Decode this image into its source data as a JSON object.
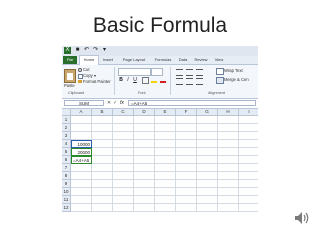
{
  "slide": {
    "title": "Basic Formula"
  },
  "tabs": [
    "File",
    "Home",
    "Insert",
    "Page Layout",
    "Formulas",
    "Data",
    "Review",
    "View"
  ],
  "ribbon": {
    "paste_label": "Paste",
    "cut_label": "Cut",
    "copy_label": "Copy ▾",
    "format_painter_label": "Format Painter",
    "clipboard_group": "Clipboard",
    "font_group": "Font",
    "alignment_group": "Alignment",
    "wrap_text_label": "Wrap Text",
    "merge_label": "Merge & Cen",
    "bold": "B",
    "italic": "I",
    "underline": "U"
  },
  "formula_bar": {
    "name_box": "SUM",
    "fx": "fx",
    "cancel": "✕",
    "enter": "✓",
    "formula": "=A4+A5"
  },
  "columns": [
    "A",
    "B",
    "C",
    "D",
    "E",
    "F",
    "G",
    "H",
    "I"
  ],
  "rows": [
    "1",
    "2",
    "3",
    "4",
    "5",
    "6",
    "7",
    "8",
    "9",
    "10",
    "11",
    "12"
  ],
  "cells": {
    "a4": "10000",
    "a5": "20000",
    "a6": "=A4+A5"
  },
  "colors": {
    "file_tab": "#2a6e2c",
    "ref_highlight": "#2a5db0",
    "active_cell_border": "#2a8a2a"
  }
}
